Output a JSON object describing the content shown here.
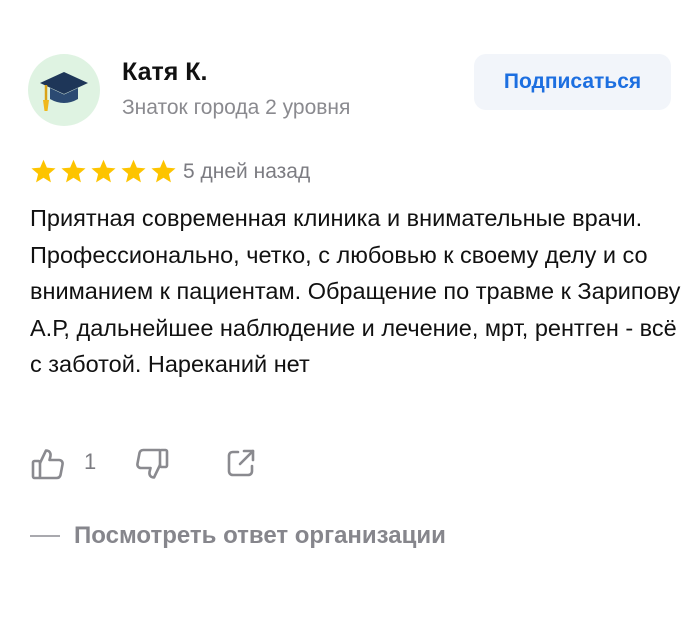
{
  "review": {
    "author_name": "Катя К.",
    "author_level": "Знаток города 2 уровня",
    "avatar_icon": "graduation-cap-icon",
    "subscribe_label": "Подписаться",
    "rating": 5,
    "rating_max": 5,
    "date": "5 дней назад",
    "text": "Приятная современная клиника и внимательные врачи. Профессионально, четко, с любовью к своему делу и со вниманием к пациентам. Обращение по травме к Зарипову А.Р, дальнейшее наблюдение и лечение, мрт, рентген - всё с заботой. Нареканий нет",
    "like_count": "1",
    "reply_link": "Посмотреть ответ организации"
  },
  "colors": {
    "accent": "#1d6fe0",
    "star": "#fdc400",
    "avatar_bg": "#dff3e2",
    "muted_text": "#8a8a8f"
  }
}
